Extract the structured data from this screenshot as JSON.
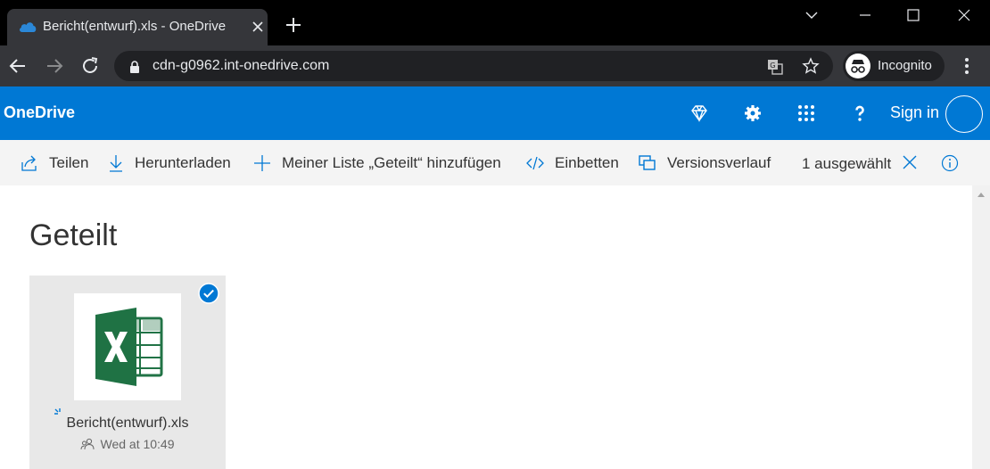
{
  "browser": {
    "tab_title": "Bericht(entwurf).xls - OneDrive",
    "url": "cdn-g0962.int-onedrive.com",
    "incognito_label": "Incognito"
  },
  "header": {
    "brand": "OneDrive",
    "signin_label": "Sign in"
  },
  "commandbar": {
    "share_label": "Teilen",
    "download_label": "Herunterladen",
    "add_to_list_label": "Meiner Liste „Geteilt“ hinzufügen",
    "embed_label": "Einbetten",
    "version_history_label": "Versionsverlauf",
    "selection_count": "1 ausgewählt"
  },
  "main": {
    "title": "Geteilt",
    "files": [
      {
        "name": "Bericht(entwurf).xls",
        "modified": "Wed at 10:49",
        "selected": true,
        "icon": "excel-icon"
      }
    ]
  },
  "colors": {
    "brand_blue": "#0078d4",
    "excel_green": "#217346",
    "chrome_dark": "#35363a"
  }
}
